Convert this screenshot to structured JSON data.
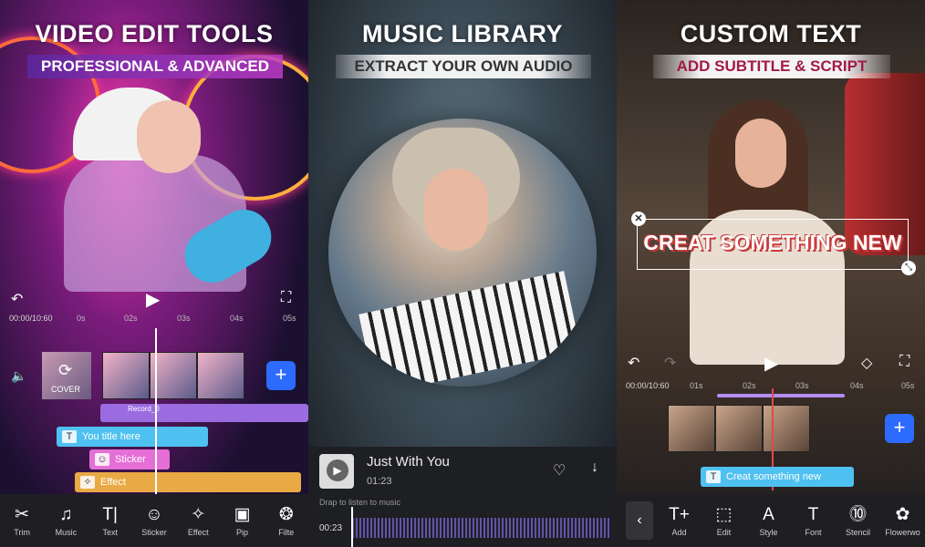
{
  "panel1": {
    "headline": "VIDEO EDIT TOOLS",
    "subheadline": "PROFESSIONAL & ADVANCED",
    "time_current": "00:00/10:60",
    "ticks": [
      "0s",
      "02s",
      "03s",
      "04s",
      "05s"
    ],
    "cover_label": "COVER",
    "tracks": {
      "record": "Record_0",
      "title": "You title here",
      "sticker": "Sticker",
      "effect": "Effect"
    },
    "colors": {
      "record": "#9b6be0",
      "title": "#4fc1f0",
      "sticker": "#e56fd6",
      "effect": "#e9aa45",
      "plus": "#2d6bff"
    },
    "tools": [
      {
        "label": "Trim",
        "icon": "scissors-icon",
        "glyph": "✂"
      },
      {
        "label": "Music",
        "icon": "music-icon",
        "glyph": "♫"
      },
      {
        "label": "Text",
        "icon": "text-icon",
        "glyph": "T|"
      },
      {
        "label": "Sticker",
        "icon": "sticker-icon",
        "glyph": "☺"
      },
      {
        "label": "Effect",
        "icon": "effect-icon",
        "glyph": "✧"
      },
      {
        "label": "Pip",
        "icon": "pip-icon",
        "glyph": "▣"
      },
      {
        "label": "Filte",
        "icon": "filter-icon",
        "glyph": "❂"
      }
    ]
  },
  "panel2": {
    "headline": "MUSIC LIBRARY",
    "subheadline": "EXTRACT YOUR OWN AUDIO",
    "song_title": "Just With You",
    "song_duration": "01:23",
    "hint": "Drap to listen to music",
    "wave_time": "00:23"
  },
  "panel3": {
    "headline": "CUSTOM TEXT",
    "subheadline": "ADD SUBTITLE & SCRIPT",
    "overlay_text": "CREAT SOMETHING NEW",
    "time_current": "00:00/10:60",
    "ticks": [
      "01s",
      "02s",
      "03s",
      "04s",
      "05s"
    ],
    "text_track": "Creat something new",
    "colors": {
      "text_track": "#4fc1f0",
      "plus": "#2d6bff",
      "headline_sub": "#a11a4a"
    },
    "tools": [
      {
        "label": "Add",
        "icon": "add-text-icon",
        "glyph": "T+"
      },
      {
        "label": "Edit",
        "icon": "edit-icon",
        "glyph": "⬚"
      },
      {
        "label": "Style",
        "icon": "style-icon",
        "glyph": "A"
      },
      {
        "label": "Font",
        "icon": "font-icon",
        "glyph": "T"
      },
      {
        "label": "Stencil",
        "icon": "stencil-icon",
        "glyph": "⓾"
      },
      {
        "label": "Flowerwo",
        "icon": "flowerword-icon",
        "glyph": "✿"
      }
    ]
  }
}
